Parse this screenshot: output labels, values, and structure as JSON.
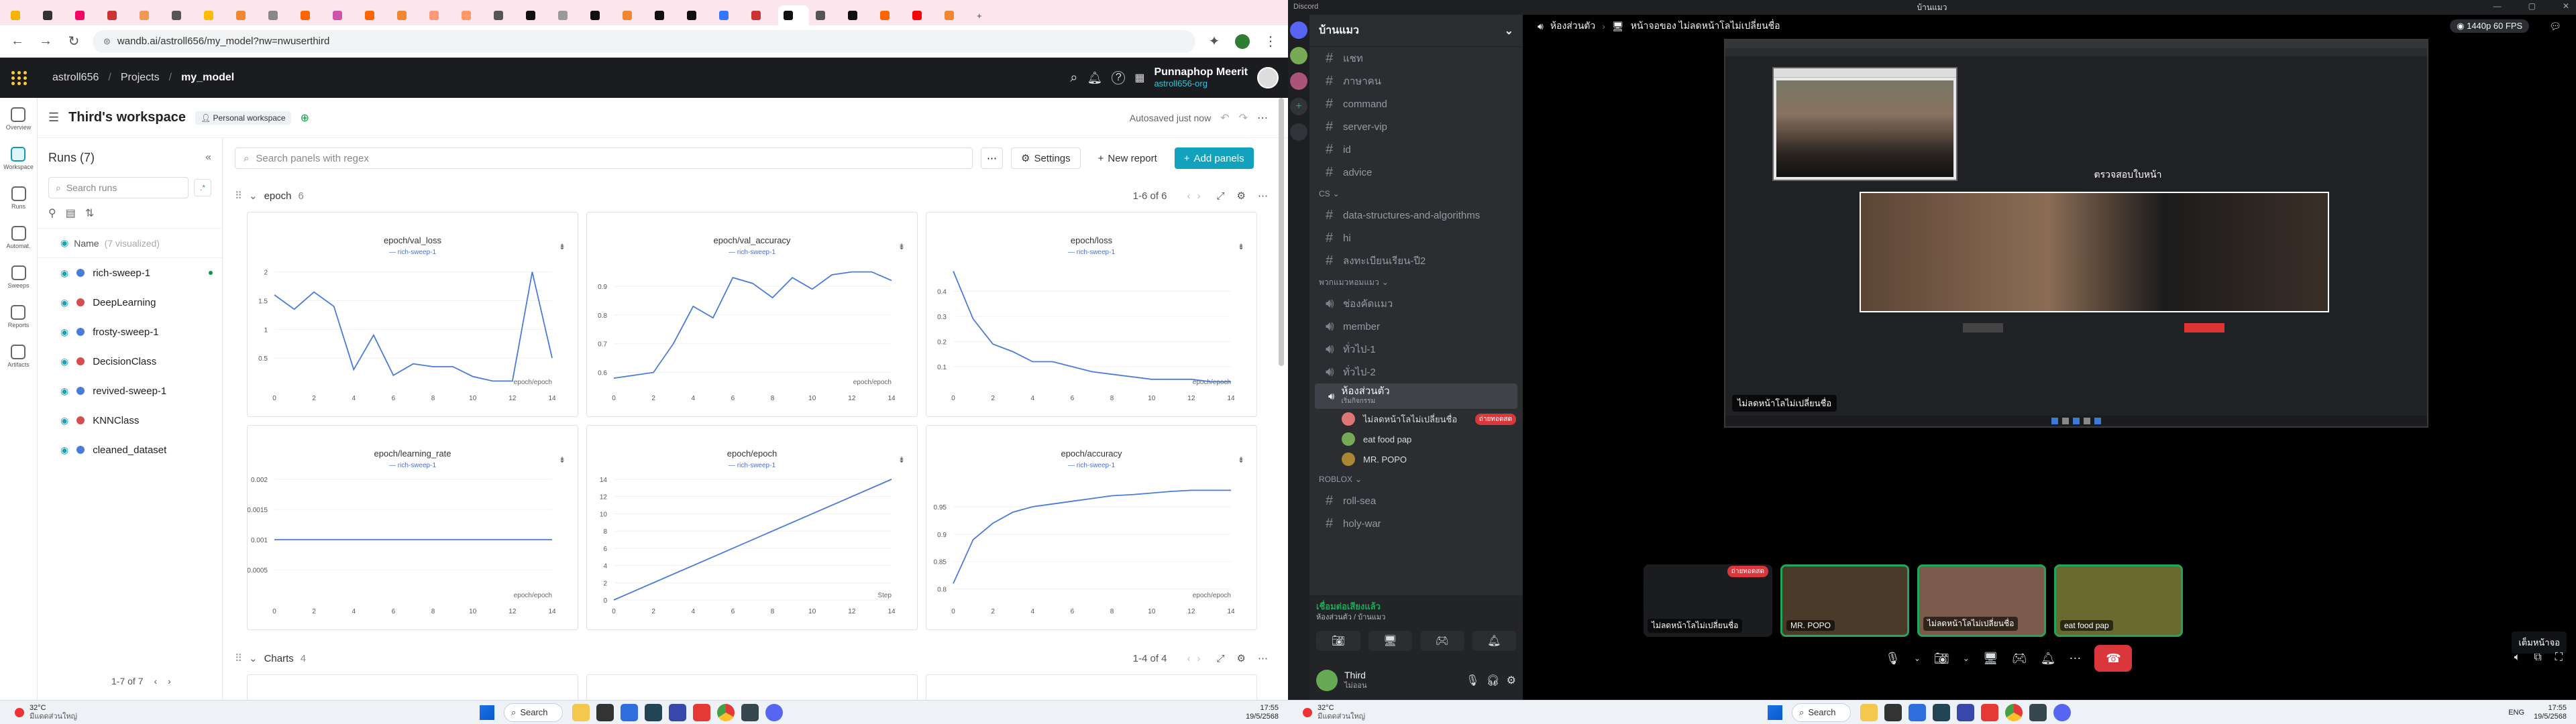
{
  "chrome": {
    "url": "wandb.ai/astroll656/my_model?nw=nwuserthird",
    "tab_colors": [
      "#f4b400",
      "#333",
      "#f06",
      "#c33",
      "#e95",
      "#555",
      "#fb0",
      "#e83",
      "#888",
      "#f60",
      "#c5a",
      "#f60",
      "#e83",
      "#f97",
      "#f96",
      "#555",
      "#111",
      "#999",
      "#111",
      "#e83",
      "#111",
      "#111",
      "#37f",
      "#c33",
      "#111",
      "#555",
      "#111",
      "#f60",
      "#f00",
      "#e83"
    ]
  },
  "wandb": {
    "breadcrumb_user": "astroll656",
    "breadcrumb_projects": "Projects",
    "breadcrumb_model": "my_model",
    "user_name": "Punnaphop Meerit",
    "user_org": "astroll656-org",
    "workspace_title": "Third's workspace",
    "workspace_badge": "Personal workspace",
    "autosaved": "Autosaved just now",
    "nav": [
      "Overview",
      "Workspace",
      "Runs",
      "Automat.",
      "Sweeps",
      "Reports",
      "Artifacts"
    ],
    "runs_title": "Runs (7)",
    "search_runs": "Search runs",
    "search_panels": "Search panels with regex",
    "name_header": "Name",
    "name_visualized": "(7 visualized)",
    "settings_label": "Settings",
    "new_report_label": "New report",
    "add_panels_label": "Add panels",
    "section_epoch": "epoch",
    "section_epoch_count": "6",
    "section_epoch_range": "1-6 of 6",
    "section_charts": "Charts",
    "section_charts_count": "4",
    "section_charts_range": "1-4 of 4",
    "pagination": "1-7 of 7",
    "runs": [
      {
        "name": "rich-sweep-1",
        "color": "#4a7bd8"
      },
      {
        "name": "DeepLearning",
        "color": "#d94c4c"
      },
      {
        "name": "frosty-sweep-1",
        "color": "#4a7bd8"
      },
      {
        "name": "DecisionClass",
        "color": "#d94c4c"
      },
      {
        "name": "revived-sweep-1",
        "color": "#4a7bd8"
      },
      {
        "name": "KNNClass",
        "color": "#d94c4c"
      },
      {
        "name": "cleaned_dataset",
        "color": "#4a7bd8"
      }
    ]
  },
  "chart_data": [
    {
      "type": "line",
      "title": "epoch/val_loss",
      "legend": "rich-sweep-1",
      "xlabel": "epoch/epoch",
      "x": [
        0,
        1,
        2,
        3,
        4,
        5,
        6,
        7,
        8,
        9,
        10,
        11,
        12,
        13,
        14
      ],
      "values": [
        1.6,
        1.35,
        1.65,
        1.4,
        0.3,
        0.9,
        0.2,
        0.4,
        0.35,
        0.35,
        0.18,
        0.1,
        0.1,
        2.0,
        0.5
      ],
      "yticks": [
        "2",
        "1.5",
        "1",
        "0.5"
      ],
      "xticks": [
        "0",
        "2",
        "4",
        "6",
        "8",
        "10",
        "12",
        "14"
      ],
      "ylim": [
        0,
        2.1
      ]
    },
    {
      "type": "line",
      "title": "epoch/val_accuracy",
      "legend": "rich-sweep-1",
      "xlabel": "epoch/epoch",
      "x": [
        0,
        1,
        2,
        3,
        4,
        5,
        6,
        7,
        8,
        9,
        10,
        11,
        12,
        13,
        14
      ],
      "values": [
        0.58,
        0.59,
        0.6,
        0.7,
        0.83,
        0.79,
        0.93,
        0.91,
        0.86,
        0.93,
        0.89,
        0.94,
        0.95,
        0.95,
        0.92
      ],
      "yticks": [
        "0.9",
        "0.8",
        "0.7",
        "0.6"
      ],
      "xticks": [
        "0",
        "2",
        "4",
        "6",
        "8",
        "10",
        "12",
        "14"
      ],
      "ylim": [
        0.55,
        0.97
      ]
    },
    {
      "type": "line",
      "title": "epoch/loss",
      "legend": "rich-sweep-1",
      "xlabel": "epoch/epoch",
      "x": [
        0,
        1,
        2,
        3,
        4,
        5,
        6,
        7,
        8,
        9,
        10,
        11,
        12,
        13,
        14
      ],
      "values": [
        0.48,
        0.29,
        0.19,
        0.16,
        0.12,
        0.12,
        0.1,
        0.08,
        0.07,
        0.06,
        0.05,
        0.05,
        0.05,
        0.04,
        0.04
      ],
      "yticks": [
        "0.4",
        "0.3",
        "0.2",
        "0.1"
      ],
      "xticks": [
        "0",
        "2",
        "4",
        "6",
        "8",
        "10",
        "12",
        "14"
      ],
      "ylim": [
        0.02,
        0.5
      ]
    },
    {
      "type": "line",
      "title": "epoch/learning_rate",
      "legend": "rich-sweep-1",
      "xlabel": "epoch/epoch",
      "x": [
        0,
        14
      ],
      "values": [
        0.001,
        0.001
      ],
      "yticks": [
        "0.002",
        "0.0015",
        "0.001",
        "0.0005"
      ],
      "xticks": [
        "0",
        "2",
        "4",
        "6",
        "8",
        "10",
        "12",
        "14"
      ],
      "ylim": [
        0,
        0.002
      ]
    },
    {
      "type": "line",
      "title": "epoch/epoch",
      "legend": "rich-sweep-1",
      "xlabel": "Step",
      "x": [
        0,
        14
      ],
      "values": [
        0,
        14
      ],
      "yticks": [
        "14",
        "12",
        "10",
        "8",
        "6",
        "4",
        "2",
        "0"
      ],
      "xticks": [
        "0",
        "2",
        "4",
        "6",
        "8",
        "10",
        "12",
        "14"
      ],
      "ylim": [
        0,
        14
      ]
    },
    {
      "type": "line",
      "title": "epoch/accuracy",
      "legend": "rich-sweep-1",
      "xlabel": "epoch/epoch",
      "x": [
        0,
        1,
        2,
        3,
        4,
        5,
        6,
        7,
        8,
        9,
        10,
        11,
        12,
        13,
        14
      ],
      "values": [
        0.81,
        0.89,
        0.92,
        0.94,
        0.95,
        0.955,
        0.96,
        0.965,
        0.97,
        0.972,
        0.975,
        0.978,
        0.98,
        0.98,
        0.98
      ],
      "yticks": [
        "0.95",
        "0.9",
        "0.85",
        "0.8"
      ],
      "xticks": [
        "0",
        "2",
        "4",
        "6",
        "8",
        "10",
        "12",
        "14"
      ],
      "ylim": [
        0.78,
        1.0
      ]
    }
  ],
  "taskbar_left": {
    "weather": "32°C",
    "weather_sub": "มีแดดส่วนใหญ่",
    "search": "Search",
    "time": "17:55",
    "date": "19/5/2568"
  },
  "discord": {
    "titlebar": "บ้านแมว",
    "server_name": "บ้านแมว",
    "text_channels": [
      "แชท",
      "ภาษาคน",
      "command",
      "server-vip",
      "id",
      "advice"
    ],
    "cs_category": "CS",
    "cs_channels": [
      "data-structures-and-algorithms",
      "hi",
      "ลงทะเบียนเรียน-ปี2"
    ],
    "voice_category": "พวกแมวหอมแมว",
    "voice_channels": [
      "ช่องคัดแมว",
      "member",
      "ทั่วไป-1",
      "ทั่วไป-2"
    ],
    "active_voice": "ห้องส่วนตัว",
    "active_voice_sub": "เริ่มกิจกรรม",
    "voice_members": [
      "ไม่ลดหน้าโลไม่เปลี่ยนชื่อ",
      "eat food pap",
      "MR. POPO"
    ],
    "live_badge": "ถ่ายทอดสด",
    "roblox_category": "ROBLOX",
    "roblox_channels": [
      "roll-sea",
      "holy-war"
    ],
    "connected": "เชื่อมต่อเสียงแล้ว",
    "connected_sub": "ห้องส่วนตัว / บ้านแมว",
    "user_name": "Third",
    "user_status": "ไม่ออน",
    "header_channel": "ห้องส่วนตัว",
    "header_stream": "หน้าจอของ ไม่ลดหน้าโลไม่เปลี่ยนชื่อ",
    "stream_quality": "1440p 60 FPS",
    "inner_center_text": "ตรวจสอบใบหน้า",
    "stream_caption": "ไม่ลดหน้าโลไม่เปลี่ยนชื่อ",
    "tiles": [
      "ไม่ลดหน้าโลไม่เปลี่ยนชื่อ",
      "MR. POPO",
      "ไม่ลดหน้าโลไม่เปลี่ยนชื่อ",
      "eat food pap"
    ],
    "tooltip": "เต็มหน้าจอ",
    "taskbar": {
      "weather": "32°C",
      "weather_sub": "มีแดดส่วนใหญ่",
      "search": "Search",
      "lang": "ENG",
      "time": "17:55",
      "date": "19/5/2568"
    }
  }
}
